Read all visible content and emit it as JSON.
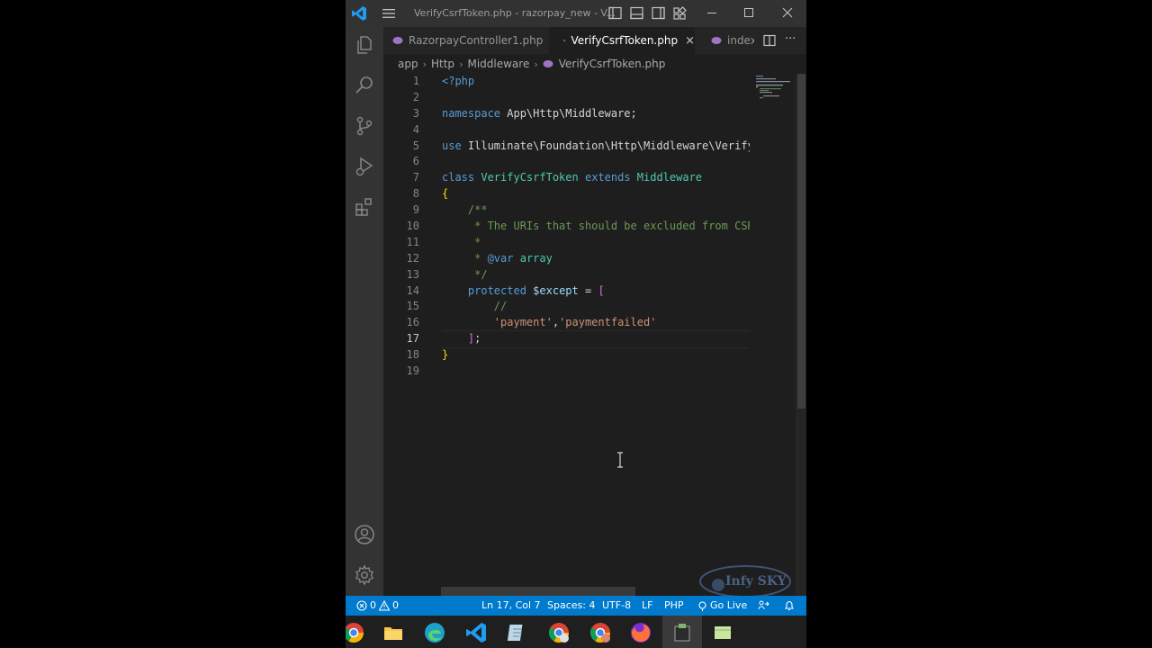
{
  "window": {
    "title": "VerifyCsrfToken.php - razorpay_new - V..."
  },
  "tabs": [
    {
      "label": "RazorpayController1.php",
      "active": false
    },
    {
      "label": "VerifyCsrfToken.php",
      "active": true,
      "close": "×"
    },
    {
      "label": "index",
      "active": false
    }
  ],
  "tab_actions": {
    "more": "···"
  },
  "breadcrumb": {
    "parts": [
      "app",
      "Http",
      "Middleware",
      "VerifyCsrfToken.php"
    ]
  },
  "editor": {
    "current_line": 17,
    "line_numbers": [
      "1",
      "2",
      "3",
      "4",
      "5",
      "6",
      "7",
      "8",
      "9",
      "10",
      "11",
      "12",
      "13",
      "14",
      "15",
      "16",
      "17",
      "18",
      "19"
    ],
    "lines": [
      "<?php",
      "",
      "namespace App\\Http\\Middleware;",
      "",
      "use Illuminate\\Foundation\\Http\\Middleware\\Verify",
      "",
      "class VerifyCsrfToken extends Middleware",
      "{",
      "    /**",
      "     * The URIs that should be excluded from CSR",
      "     *",
      "     * @var array",
      "     */",
      "    protected $except = [",
      "        //",
      "        'payment','paymentfailed'",
      "    ];",
      "}",
      ""
    ]
  },
  "statusbar": {
    "errors": "0",
    "warnings": "0",
    "position": "Ln 17, Col 7",
    "spaces": "Spaces: 4",
    "encoding": "UTF-8",
    "eol": "LF",
    "language": "PHP",
    "go_live": "Go Live"
  },
  "watermark": {
    "text": "Infy SKY"
  },
  "colors": {
    "accent": "#007acc",
    "editor_bg": "#1e1e1e",
    "activity_bar": "#333333",
    "tab_bar": "#252526"
  },
  "taskbar_icons": [
    "chrome-icon",
    "file-explorer-icon",
    "edge-icon",
    "vscode-icon",
    "notepad-icon",
    "chrome-profile-icon",
    "chrome-profile-2-icon",
    "firefox-icon",
    "terminal-icon",
    "notes-icon"
  ]
}
